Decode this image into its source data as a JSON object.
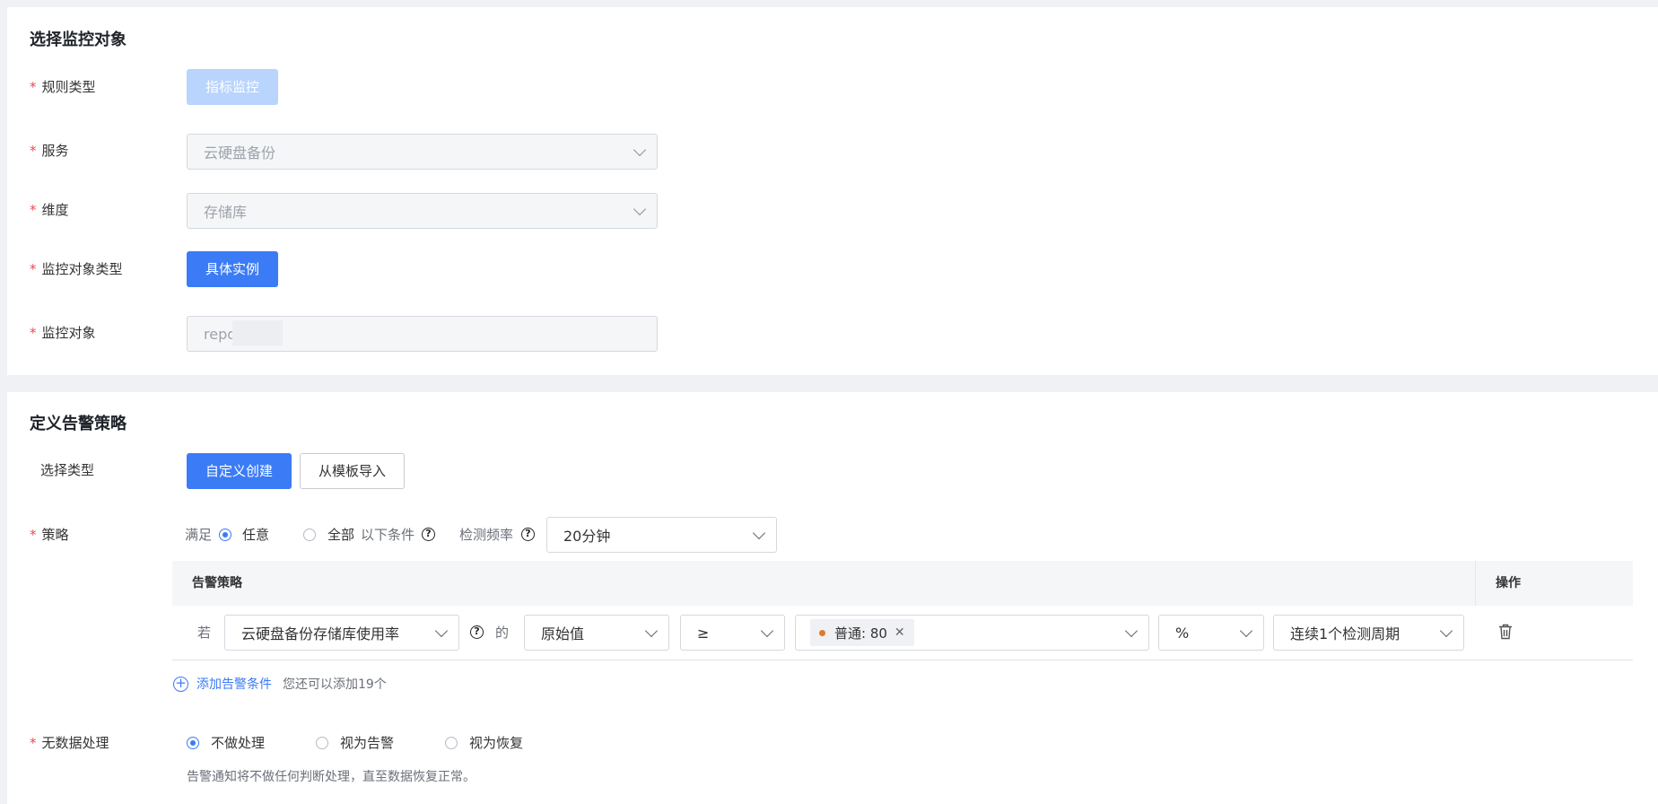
{
  "section1": {
    "title": "选择监控对象",
    "rule_type": {
      "label": "规则类型",
      "button": "指标监控"
    },
    "service": {
      "label": "服务",
      "value": "云硬盘备份"
    },
    "dimension": {
      "label": "维度",
      "value": "存储库"
    },
    "object_type": {
      "label": "监控对象类型",
      "button": "具体实例"
    },
    "object": {
      "label": "监控对象",
      "value": "repo"
    }
  },
  "section2": {
    "title": "定义告警策略",
    "select_type": {
      "label": "选择类型",
      "custom": "自定义创建",
      "template": "从模板导入"
    },
    "policy": {
      "label": "策略",
      "satisfy": "满足",
      "any": "任意",
      "all": "全部",
      "conditions": "以下条件",
      "freq_label": "检测频率",
      "freq_value": "20分钟",
      "table": {
        "col_policy": "告警策略",
        "col_action": "操作",
        "row": {
          "if": "若",
          "metric": "云硬盘备份存储库使用率",
          "of": "的",
          "stat": "原始值",
          "op": "≥",
          "tag": "普通: 80",
          "unit": "%",
          "period": "连续1个检测周期"
        }
      },
      "add_link": "添加告警条件",
      "add_hint": "您还可以添加19个"
    },
    "nodata": {
      "label": "无数据处理",
      "opt1": "不做处理",
      "opt2": "视为告警",
      "opt3": "视为恢复",
      "hint": "告警通知将不做任何判断处理，直至数据恢复正常。"
    }
  },
  "colors": {
    "primary": "#3b7bf6",
    "required": "#e34d59",
    "warning_dot": "#e07a2c"
  }
}
